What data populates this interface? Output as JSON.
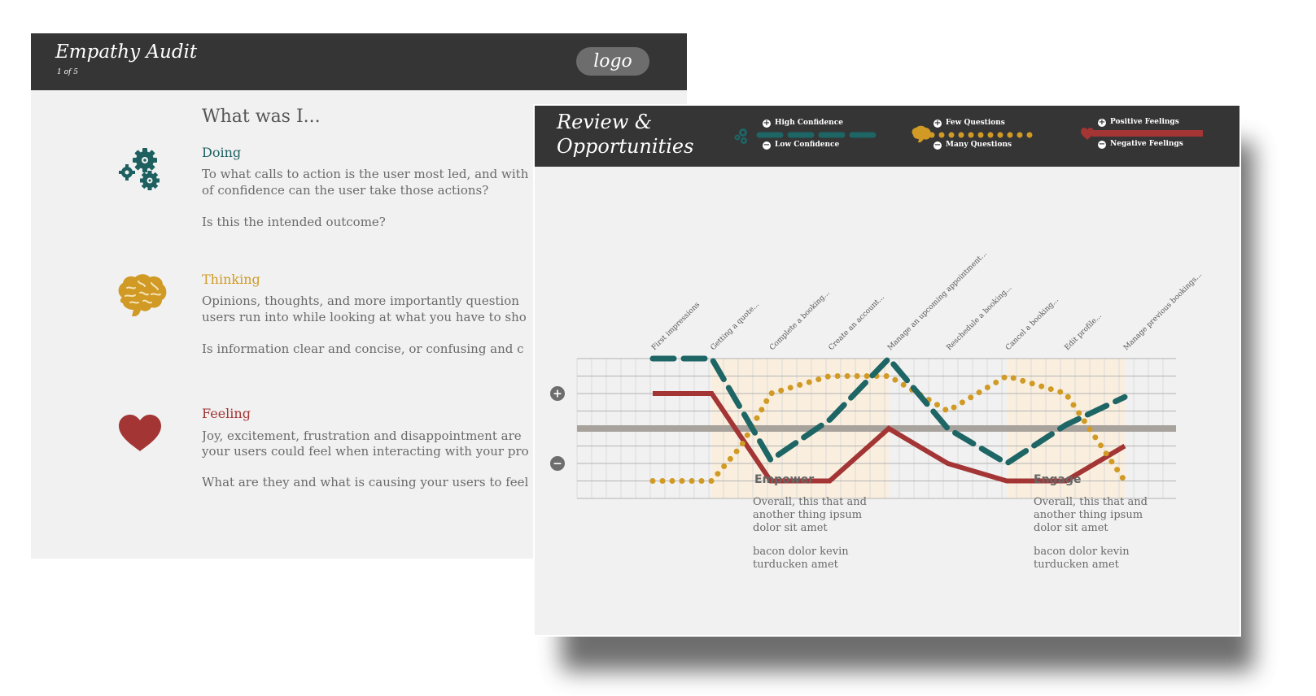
{
  "slide1": {
    "title": "Empathy Audit",
    "page": "1 of 5",
    "logo": "logo",
    "heading": "What was I...",
    "sections": [
      {
        "title": "Doing",
        "color": "#1e5f5f",
        "icon": "gears-icon",
        "text1": "To what calls to action is the user most led, and with",
        "text2": "of confidence can the user take those actions?",
        "text3": "Is this the intended outcome?"
      },
      {
        "title": "Thinking",
        "color": "#d09a25",
        "icon": "brain-icon",
        "text1": "Opinions, thoughts, and more importantly question",
        "text2": "users run into while looking at what you have to sho",
        "text3": "Is information clear and concise, or confusing and c"
      },
      {
        "title": "Feeling",
        "color": "#a33535",
        "icon": "heart-icon",
        "text1": "Joy, excitement, frustration and disappointment are",
        "text2": "your users could feel when interacting with your pro",
        "text3": "What are they and what is causing your users to feel"
      }
    ]
  },
  "slide2": {
    "title_line1": "Review &",
    "title_line2": "Opportunities",
    "legend": {
      "confidence_high": "High Confidence",
      "confidence_low": "Low Confidence",
      "questions_few": "Few Questions",
      "questions_many": "Many Questions",
      "feelings_positive": "Positive Feelings",
      "feelings_negative": "Negative Feelings"
    },
    "phases": [
      {
        "title": "Empower",
        "text1": "Overall, this that and\nanother thing ipsum\ndolor sit amet",
        "text2": "bacon dolor kevin\nturducken amet"
      },
      {
        "title": "Engage",
        "text1": "Overall, this that and\nanother thing ipsum\ndolor sit amet",
        "text2": "bacon dolor kevin\nturducken amet"
      }
    ]
  },
  "chart_data": {
    "type": "line",
    "categories": [
      "First impressions",
      "Getting a quote...",
      "Complete a booking...",
      "Create an account...",
      "Manage an upcoming appointment...",
      "Reschedule a booking...",
      "Cancel a booking...",
      "Edit profile...",
      "Manage previous bookings..."
    ],
    "ylim": [
      -4,
      4
    ],
    "series": [
      {
        "name": "Confidence",
        "color": "#1e6565",
        "style": "dashed",
        "points": [
          [
            0,
            4
          ],
          [
            1,
            4
          ],
          [
            2,
            -1.8
          ],
          [
            3,
            0.5
          ],
          [
            4,
            4
          ],
          [
            5,
            0
          ],
          [
            6,
            -2
          ],
          [
            7,
            0.2
          ],
          [
            8,
            1.8
          ]
        ]
      },
      {
        "name": "Questions",
        "color": "#d09a25",
        "style": "dotted",
        "points": [
          [
            0,
            -3
          ],
          [
            1,
            -3
          ],
          [
            1.5,
            -1
          ],
          [
            2,
            2
          ],
          [
            3,
            3
          ],
          [
            4,
            3
          ],
          [
            5,
            1
          ],
          [
            6,
            3
          ],
          [
            7,
            2
          ],
          [
            8,
            -3
          ]
        ]
      },
      {
        "name": "Feelings",
        "color": "#a33535",
        "style": "solid",
        "points": [
          [
            0,
            2
          ],
          [
            1,
            2
          ],
          [
            2,
            -3
          ],
          [
            3,
            -3
          ],
          [
            4,
            0
          ],
          [
            5,
            -2
          ],
          [
            6,
            -3
          ],
          [
            7,
            -3
          ],
          [
            8,
            -1
          ]
        ]
      }
    ],
    "highlight_ranges": [
      [
        1,
        4
      ],
      [
        6,
        8
      ]
    ]
  }
}
